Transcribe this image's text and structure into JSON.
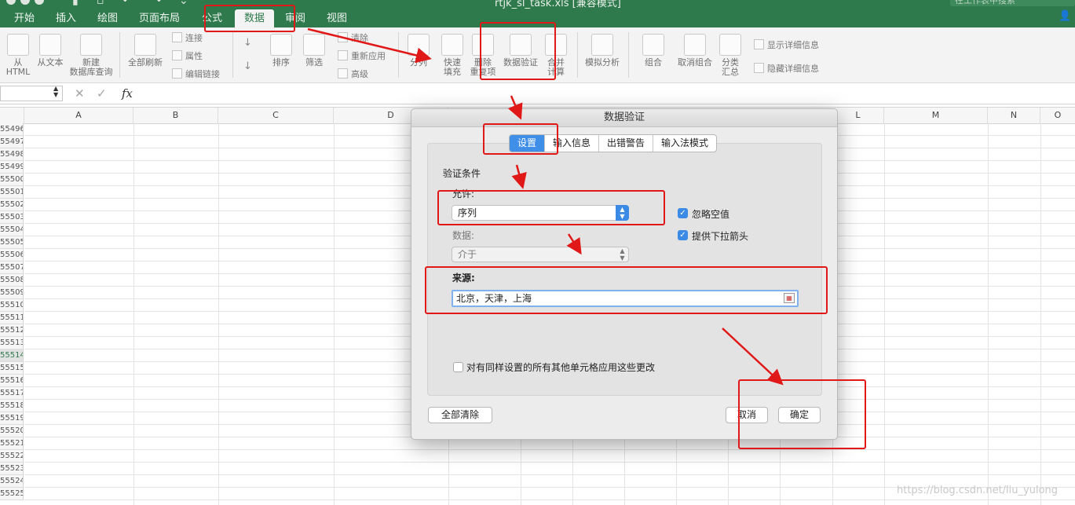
{
  "app": {
    "doc_title": "rtjk_sl_task.xls [兼容模式]",
    "search_placeholder": "在工作表中搜索"
  },
  "tabs": [
    {
      "label": "开始"
    },
    {
      "label": "插入"
    },
    {
      "label": "绘图"
    },
    {
      "label": "页面布局"
    },
    {
      "label": "公式"
    },
    {
      "label": "数据",
      "active": true
    },
    {
      "label": "审阅"
    },
    {
      "label": "视图"
    }
  ],
  "ribbon": {
    "from_html_1": "从",
    "from_html_2": "HTML",
    "from_text": "从文本",
    "new_query_1": "新建",
    "new_query_2": "数据库查询",
    "refresh_all": "全部刷新",
    "connections": "连接",
    "properties": "属性",
    "edit_links": "编辑链接",
    "sort": "排序",
    "filter": "筛选",
    "clear": "清除",
    "reapply": "重新应用",
    "advanced": "高级",
    "text_to_columns": "分列",
    "flash_fill_1": "快速",
    "flash_fill_2": "填充",
    "remove_dup_1": "删除",
    "remove_dup_2": "重复项",
    "data_validation": "数据验证",
    "consolidate_1": "合并",
    "consolidate_2": "计算",
    "what_if": "模拟分析",
    "group": "组合",
    "ungroup": "取消组合",
    "subtotal_1": "分类",
    "subtotal_2": "汇总",
    "show_detail": "显示详细信息",
    "hide_detail": "隐藏详细信息"
  },
  "formula_bar": {
    "fx": "fx",
    "namebox_value": ""
  },
  "columns": [
    "A",
    "B",
    "C",
    "D",
    "L",
    "M",
    "N",
    "O"
  ],
  "rows": [
    "55496",
    "55497",
    "55498",
    "55499",
    "55500",
    "55501",
    "55502",
    "55503",
    "55504",
    "55505",
    "55506",
    "55507",
    "55508",
    "55509",
    "55510",
    "55511",
    "55512",
    "55513",
    "55514",
    "55515",
    "55516",
    "55517",
    "55518",
    "55519",
    "55520",
    "55521",
    "55522",
    "55523",
    "55524",
    "55525"
  ],
  "dialog": {
    "title": "数据验证",
    "tabs": [
      {
        "label": "设置",
        "active": true
      },
      {
        "label": "输入信息"
      },
      {
        "label": "出错警告"
      },
      {
        "label": "输入法模式"
      }
    ],
    "criteria_heading": "验证条件",
    "allow_label": "允许:",
    "allow_value": "序列",
    "data_label": "数据:",
    "data_value": "介于",
    "ignore_blank_label": "忽略空值",
    "ignore_blank_checked": true,
    "dropdown_label": "提供下拉箭头",
    "dropdown_checked": true,
    "source_label": "来源:",
    "source_value": "北京，天津，上海",
    "apply_all_label": "对有同样设置的所有其他单元格应用这些更改",
    "apply_all_checked": false,
    "clear_all_button": "全部清除",
    "cancel_button": "取消",
    "ok_button": "确定"
  },
  "watermark": "https://blog.csdn.net/liu_yulong",
  "colors": {
    "excel_green": "#2e7a4c",
    "accent_blue": "#3a8ae6",
    "annotation_red": "#e01818"
  }
}
